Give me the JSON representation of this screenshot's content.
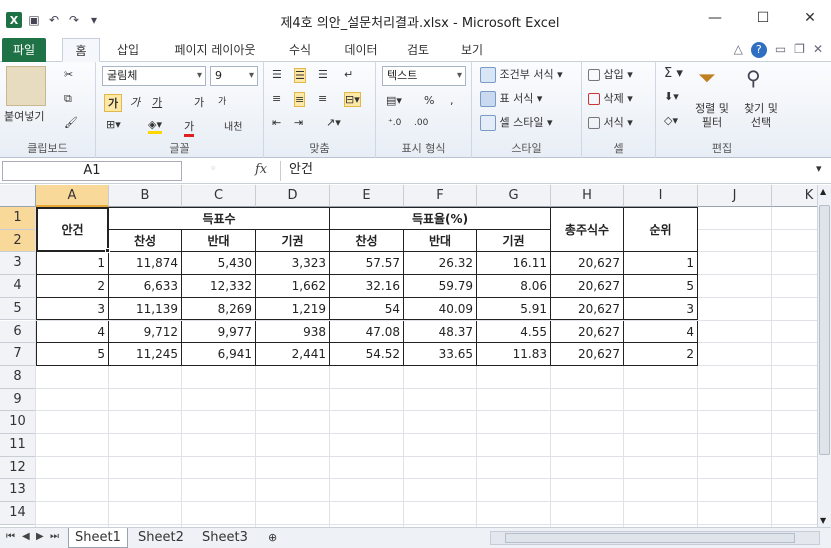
{
  "title": "제4호 의안_설문처리결과.xlsx - Microsoft Excel",
  "tabs": [
    "파일",
    "홈",
    "삽입",
    "페이지 레이아웃",
    "수식",
    "데이터",
    "검토",
    "보기"
  ],
  "ribbon": {
    "clipboard": {
      "paste": "붙여넣기",
      "label": "클립보드"
    },
    "font": {
      "font_name": "굴림체",
      "font_size": "9",
      "bold": "가",
      "italic": "가",
      "underline": "가",
      "grow": "가",
      "shrink": "가",
      "phonetic": "내천",
      "label": "글꼴"
    },
    "alignment": {
      "label": "맞춤"
    },
    "number": {
      "format": "텍스트",
      "percent": "%",
      "comma": ",",
      "label": "표시 형식"
    },
    "styles": {
      "conditional": "조건부 서식",
      "table": "표 서식",
      "cell": "셀 스타일",
      "label": "스타일"
    },
    "cells": {
      "insert": "삽입",
      "delete": "삭제",
      "format": "서식",
      "label": "셀"
    },
    "editing": {
      "sort_filter": "정렬 및 필터",
      "find_select": "찾기 및 선택",
      "label": "편집"
    }
  },
  "namebox": "A1",
  "fx": "fx",
  "formula": "안건",
  "columns": [
    "A",
    "B",
    "C",
    "D",
    "E",
    "F",
    "G",
    "H",
    "I",
    "J",
    "K"
  ],
  "rows": [
    "1",
    "2",
    "3",
    "4",
    "5",
    "6",
    "7",
    "8",
    "9",
    "10",
    "11",
    "12",
    "13",
    "14"
  ],
  "table": {
    "h_agenda": "안건",
    "h_votes": "득표수",
    "h_rate": "득표율(%)",
    "h_total": "총주식수",
    "h_rank": "순위",
    "sub": [
      "찬성",
      "반대",
      "기권",
      "찬성",
      "반대",
      "기권"
    ],
    "data": [
      [
        "1",
        "11,874",
        "5,430",
        "3,323",
        "57.57",
        "26.32",
        "16.11",
        "20,627",
        "1"
      ],
      [
        "2",
        "6,633",
        "12,332",
        "1,662",
        "32.16",
        "59.79",
        "8.06",
        "20,627",
        "5"
      ],
      [
        "3",
        "11,139",
        "8,269",
        "1,219",
        "54",
        "40.09",
        "5.91",
        "20,627",
        "3"
      ],
      [
        "4",
        "9,712",
        "9,977",
        "938",
        "47.08",
        "48.37",
        "4.55",
        "20,627",
        "4"
      ],
      [
        "5",
        "11,245",
        "6,941",
        "2,441",
        "54.52",
        "33.65",
        "11.83",
        "20,627",
        "2"
      ]
    ]
  },
  "sheets": [
    "Sheet1",
    "Sheet2",
    "Sheet3"
  ]
}
